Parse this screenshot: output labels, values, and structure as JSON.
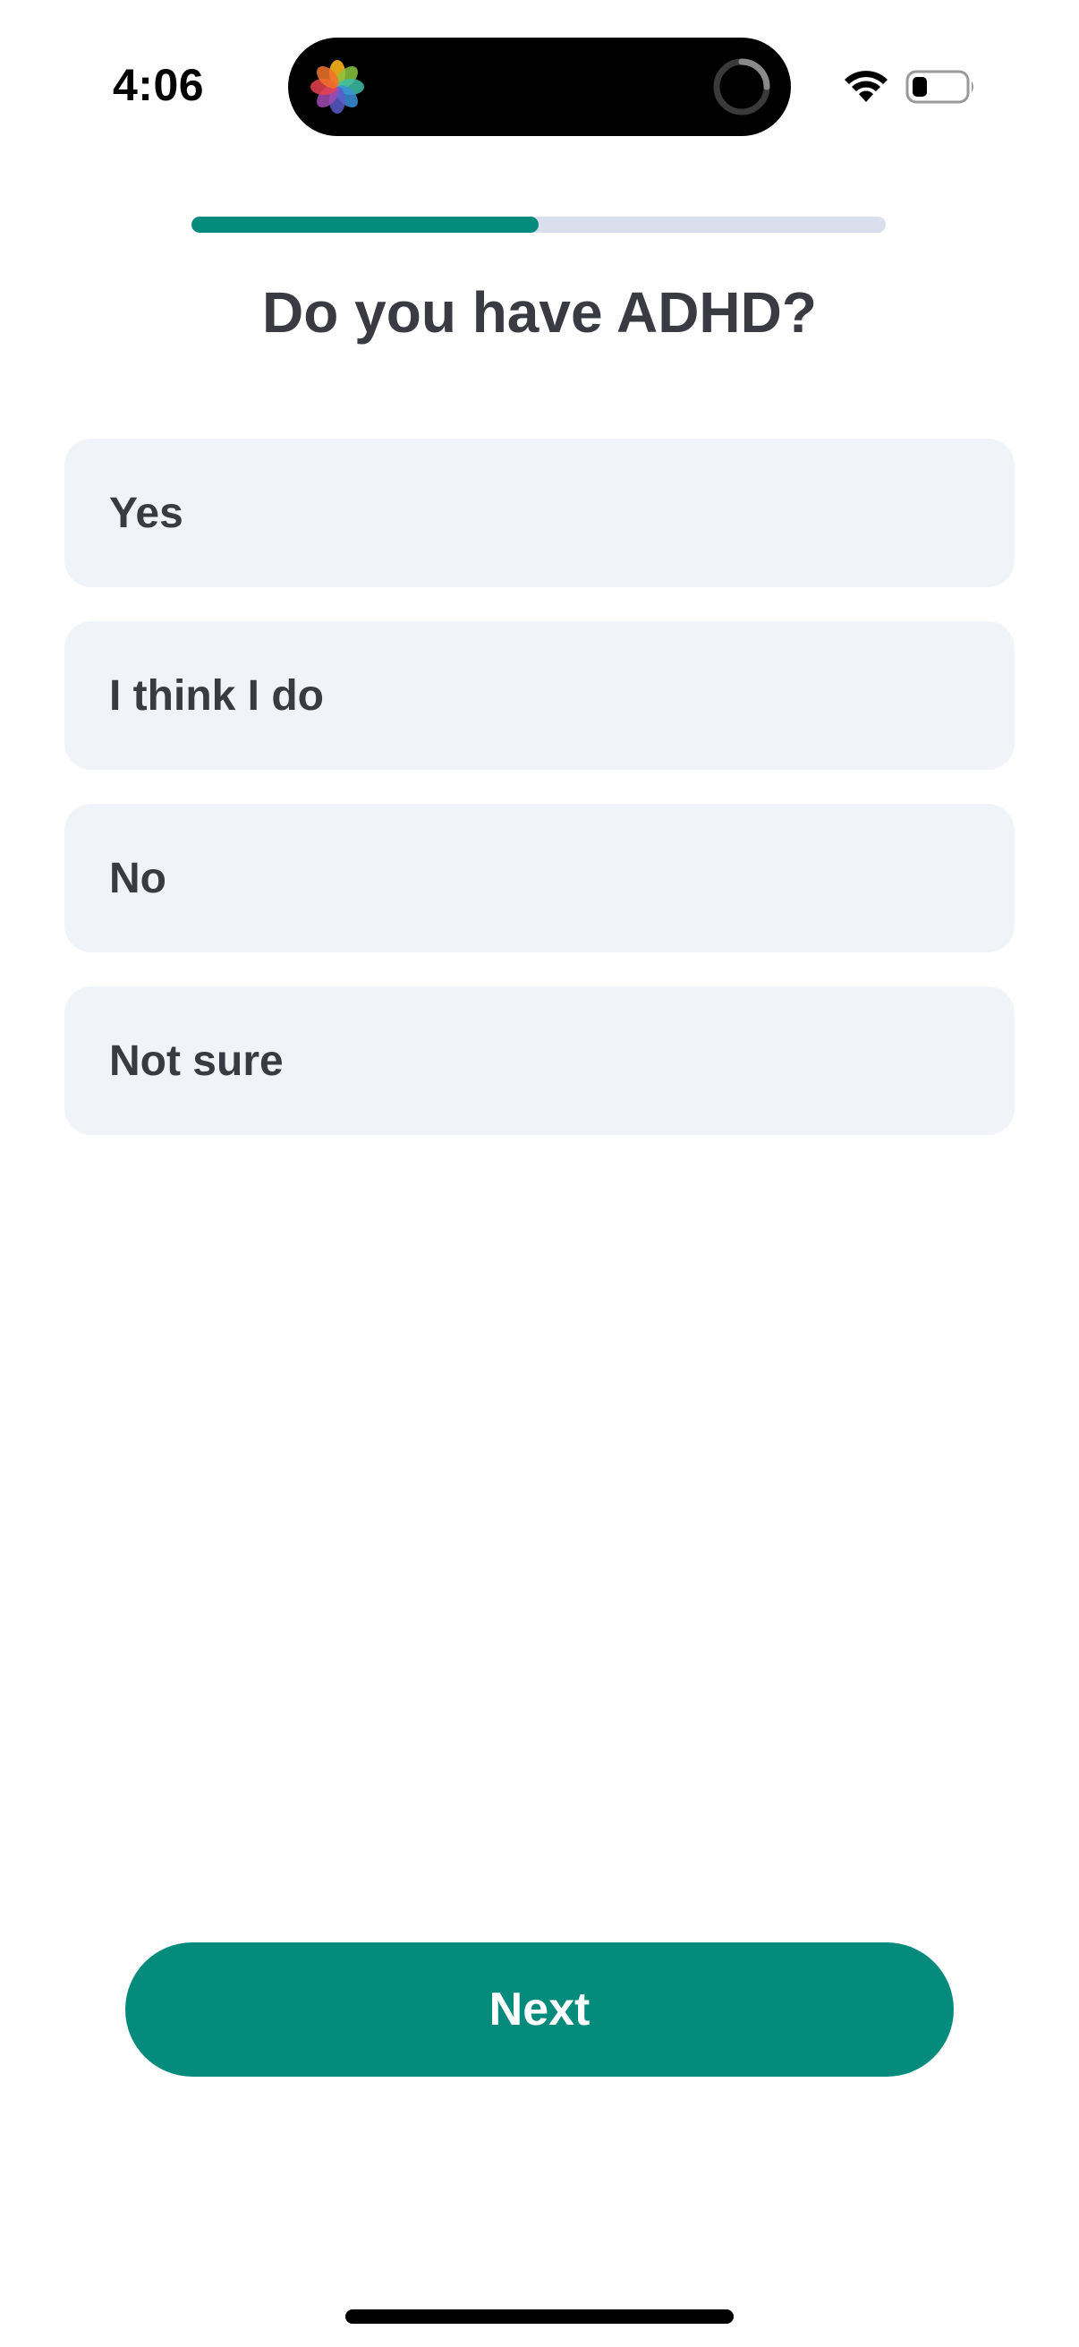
{
  "status_bar": {
    "time": "4:06",
    "icons": [
      "photos-app-icon",
      "loading-ring-icon",
      "wifi-icon",
      "battery-icon"
    ]
  },
  "progress": {
    "fraction": 0.5
  },
  "question": {
    "title": "Do you have ADHD?"
  },
  "options": [
    {
      "label": "Yes"
    },
    {
      "label": "I think I do"
    },
    {
      "label": "No"
    },
    {
      "label": "Not sure"
    }
  ],
  "actions": {
    "next_label": "Next"
  },
  "colors": {
    "accent": "#058b7c",
    "progress_track": "#d9dfec",
    "option_background": "#f0f3f8",
    "text": "#3a3b42"
  }
}
